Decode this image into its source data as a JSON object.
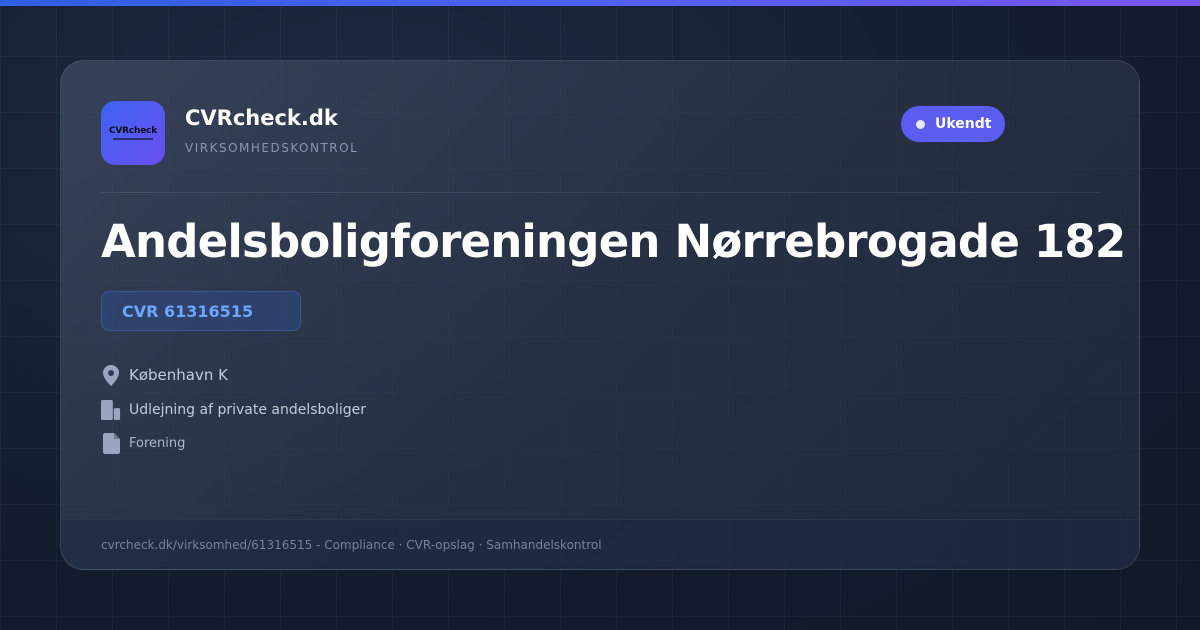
{
  "brand": {
    "name": "CVRcheck.dk",
    "tagline": "VIRKSOMHEDSKONTROL",
    "logo_text": "CVRcheck"
  },
  "status": {
    "label": "Ukendt",
    "color": "#5b5cf0"
  },
  "company": {
    "name": "Andelsboligforeningen Nørrebrogade 182",
    "cvr_label": "CVR 61316515"
  },
  "details": {
    "location": {
      "icon": "location-pin-icon",
      "text": "København K"
    },
    "industry": {
      "icon": "building-icon",
      "text": "Udlejning af private andelsboliger"
    },
    "type": {
      "icon": "document-icon",
      "text": "Forening"
    }
  },
  "footer": {
    "text": "cvrcheck.dk/virksomhed/61316515 - Compliance · CVR-opslag · Samhandelskontrol"
  },
  "colors": {
    "accent": "#5b5cf0",
    "cvr_text": "#6ea5ff",
    "top_bar_start": "#2f5fe8",
    "top_bar_end": "#7a55f0"
  }
}
